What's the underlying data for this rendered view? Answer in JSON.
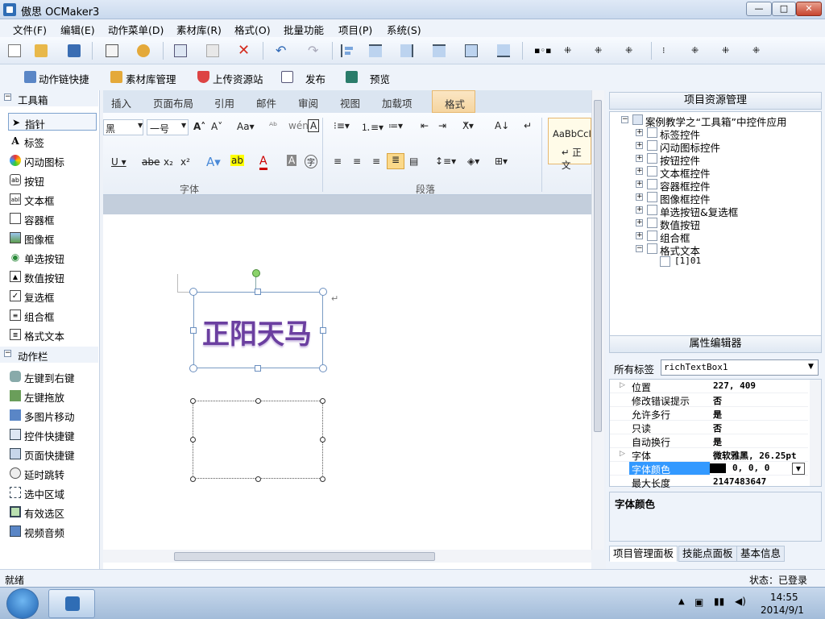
{
  "window": {
    "title": "傲思 OCMaker3",
    "min": "—",
    "max": "□",
    "close": "✕"
  },
  "menu": [
    "文件(F)",
    "编辑(E)",
    "动作菜单(D)",
    "素材库(R)",
    "格式(O)",
    "批量功能",
    "项目(P)",
    "系统(S)"
  ],
  "toolbar2": [
    "动作链快捷",
    "素材库管理",
    "上传资源站",
    "发布",
    "预览"
  ],
  "toolbox": {
    "section1": "工具箱",
    "items1": [
      "指针",
      "标签",
      "闪动图标",
      "按钮",
      "文本框",
      "容器框",
      "图像框",
      "单选按钮",
      "数值按钮",
      "复选框",
      "组合框",
      "格式文本"
    ],
    "section2": "动作栏",
    "items2": [
      "左键到右键",
      "左键拖放",
      "多图片移动",
      "控件快捷键",
      "页面快捷键",
      "延时跳转",
      "选中区域",
      "有效选区",
      "视频音频"
    ]
  },
  "ribbon": {
    "tabs": [
      "插入",
      "页面布局",
      "引用",
      "邮件",
      "审阅",
      "视图",
      "加载项",
      "格式"
    ],
    "font_name": "黑",
    "font_size": "一号",
    "group_font": "字体",
    "group_paragraph": "段落",
    "style_sample": "AaBbCcI",
    "style_name": "↵ 正文"
  },
  "document": {
    "text": "正阳天马",
    "para_mark": "↵"
  },
  "project": {
    "header": "项目资源管理",
    "root": "案例教学之“工具箱”中控件应用",
    "nodes": [
      "标签控件",
      "闪动图标控件",
      "按钮控件",
      "文本框控件",
      "容器框控件",
      "图像框控件",
      "单选按钮&复选框",
      "数值按钮",
      "组合框",
      "格式文本"
    ],
    "leaf": "[1]01"
  },
  "properties": {
    "header": "属性编辑器",
    "label": "所有标签",
    "selected": "richTextBox1",
    "rows": [
      {
        "k": "位置",
        "v": "227, 409",
        "expand": true
      },
      {
        "k": "修改错误提示",
        "v": "否"
      },
      {
        "k": "允许多行",
        "v": "是"
      },
      {
        "k": "只读",
        "v": "否"
      },
      {
        "k": "自动换行",
        "v": "是"
      },
      {
        "k": "字体",
        "v": "微软雅黑, 26.25pt",
        "expand": true
      },
      {
        "k": "字体颜色",
        "v": "0, 0, 0",
        "selected": true
      },
      {
        "k": "最大长度",
        "v": "2147483647"
      }
    ],
    "description": "字体颜色"
  },
  "bottom_tabs": [
    "项目管理面板",
    "技能点面板",
    "基本信息"
  ],
  "status": {
    "left": "就绪",
    "right": "状态：已登录"
  },
  "clock": {
    "time": "14:55",
    "date": "2014/9/1"
  },
  "colors": {
    "accent": "#3399ff",
    "text_purple": "#6b3fa0",
    "format_tab": "#f5d5a0"
  }
}
